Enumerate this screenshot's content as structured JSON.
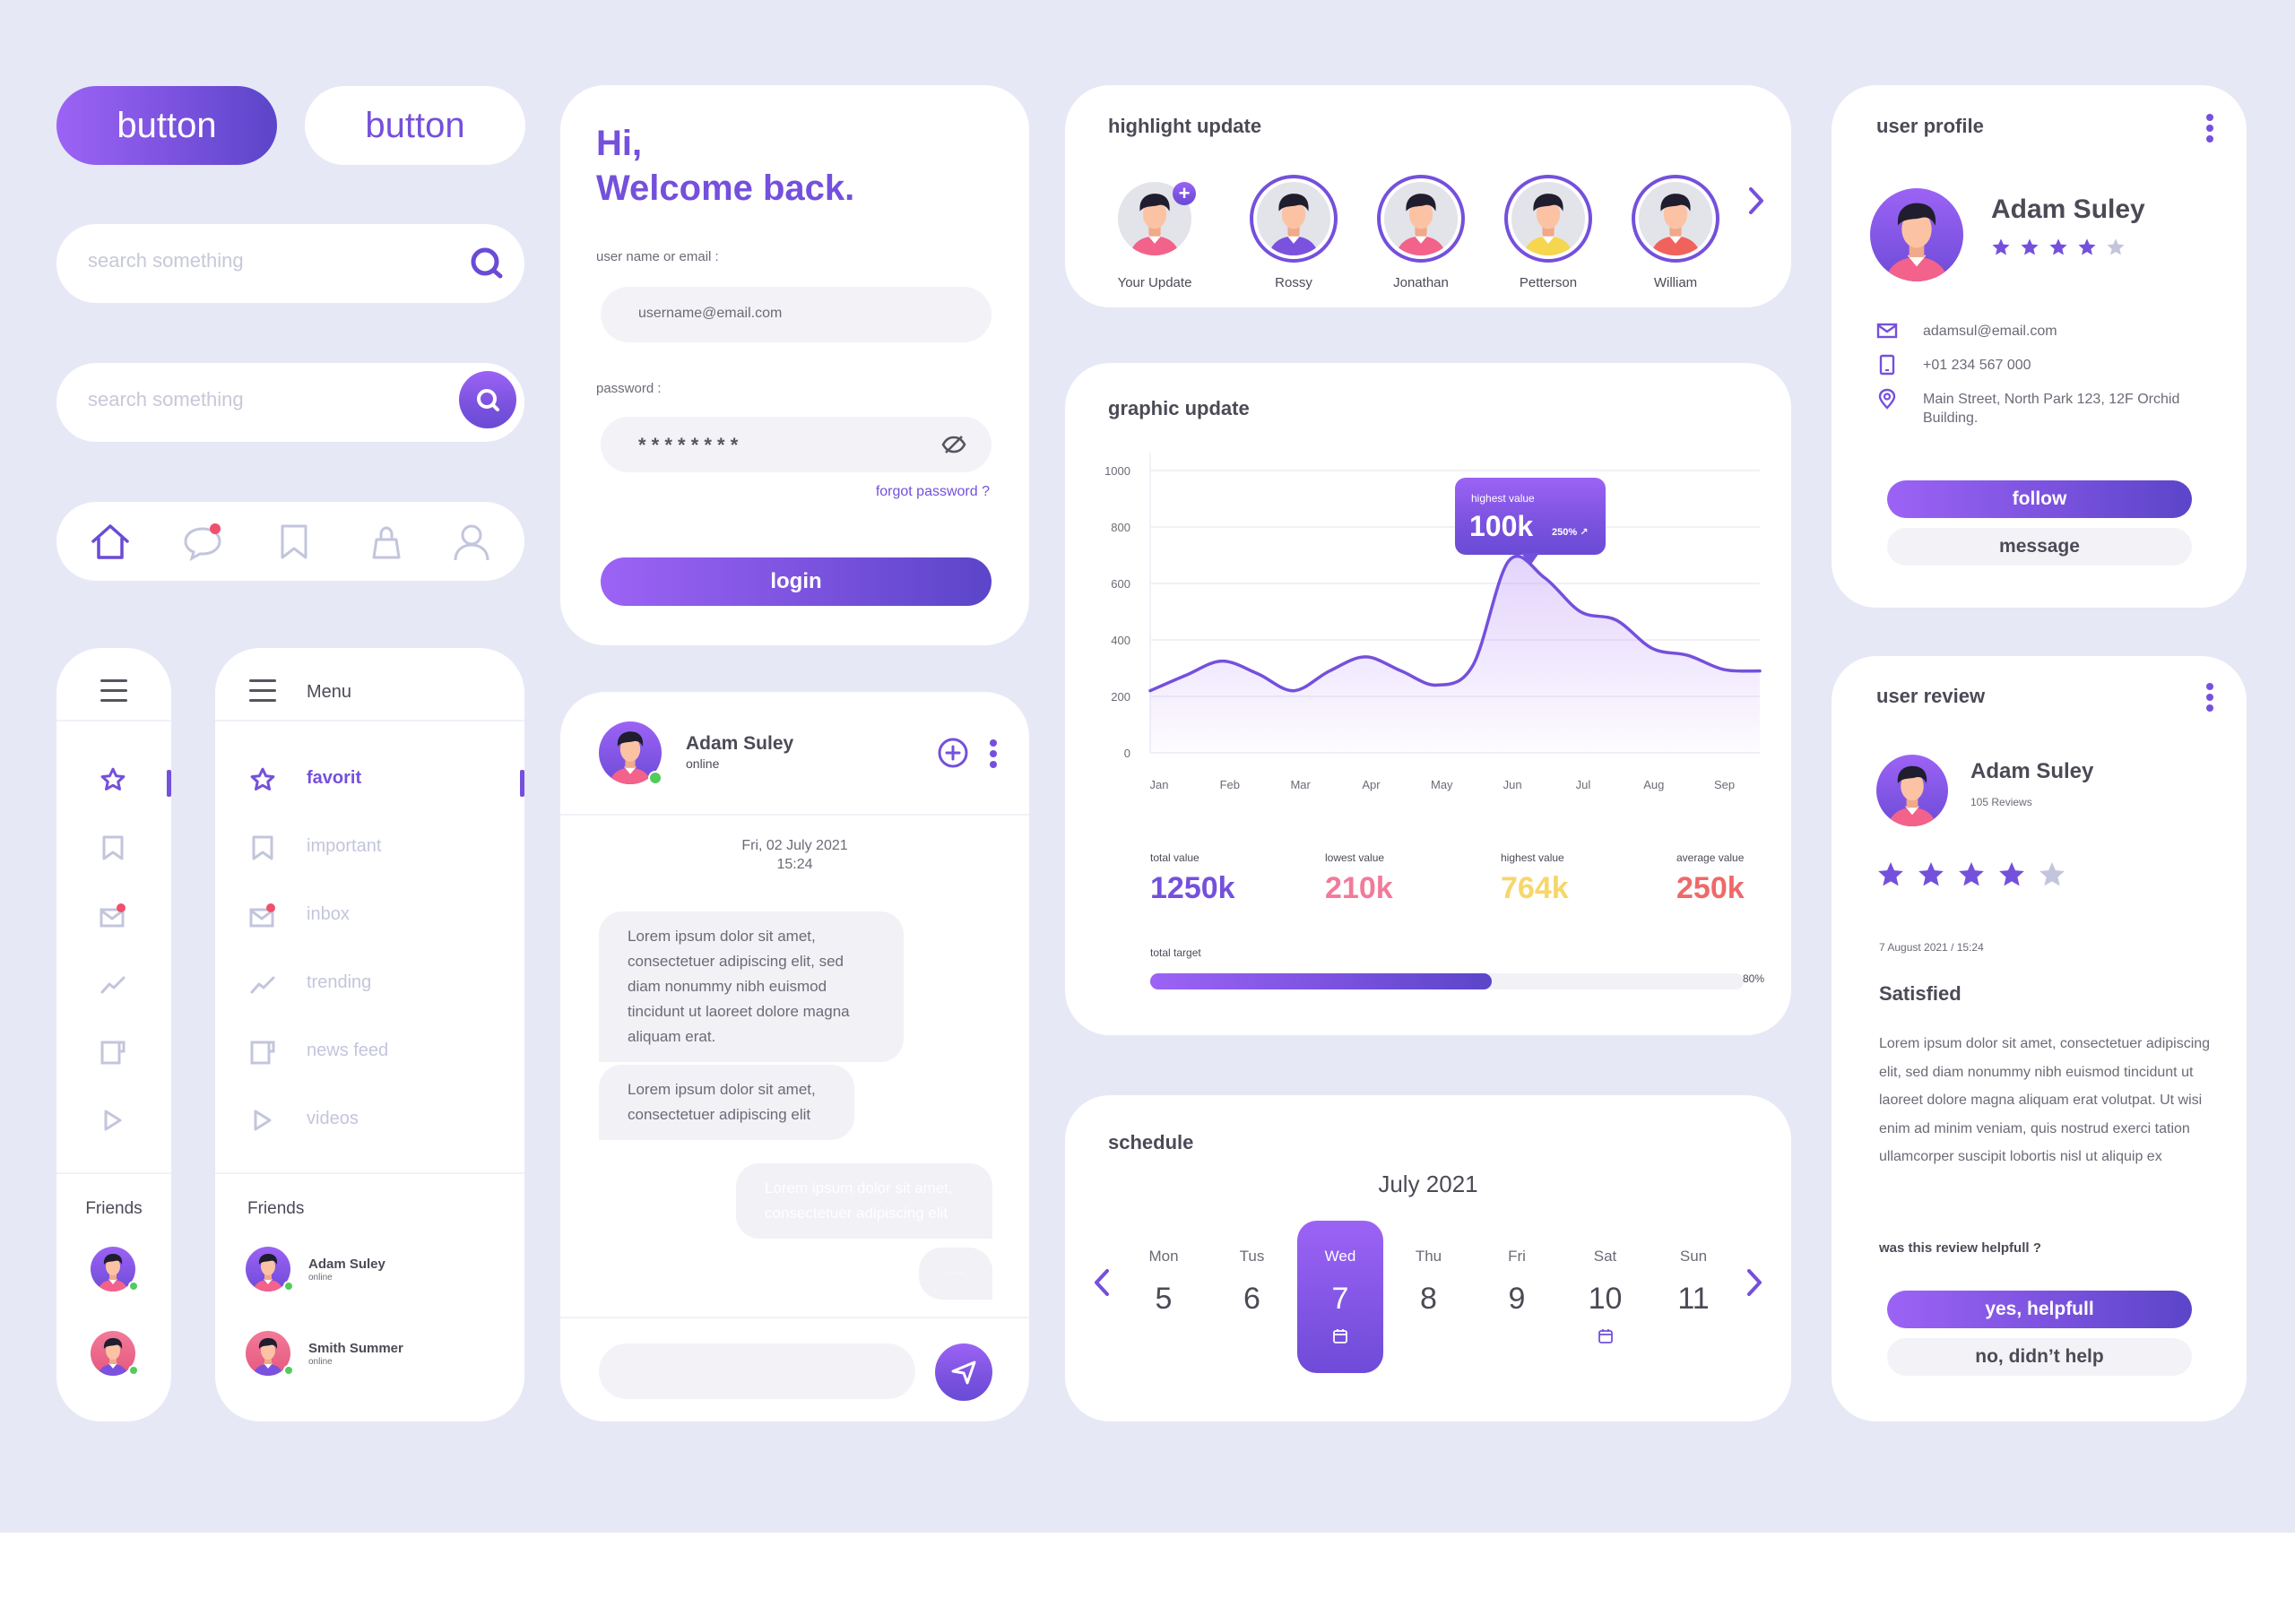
{
  "colors": {
    "background": "#e6e8f6",
    "accent": "#7450dc",
    "accent_light": "#9c63f5",
    "muted_icon": "#c3c5dc",
    "online": "#52cc5a",
    "notification": "#f0506e",
    "stat_total": "#7450dc",
    "stat_lowest": "#f27a9a",
    "stat_highest": "#f7d66a",
    "stat_average": "#f06868"
  },
  "buttons": {
    "primary_label": "button",
    "secondary_label": "button"
  },
  "search": {
    "placeholder_1": "search something",
    "placeholder_2": "search something"
  },
  "bottom_nav": {
    "items": [
      {
        "icon": "home-icon",
        "active": true
      },
      {
        "icon": "chat-icon",
        "badge": true
      },
      {
        "icon": "bookmark-icon"
      },
      {
        "icon": "shopping-bag-icon"
      },
      {
        "icon": "user-icon"
      }
    ]
  },
  "sidebar": {
    "menu_title": "Menu",
    "items": [
      {
        "label": "favorit",
        "icon": "star-icon",
        "active": true
      },
      {
        "label": "important",
        "icon": "bookmark-icon"
      },
      {
        "label": "inbox",
        "icon": "mail-icon",
        "badge": true
      },
      {
        "label": "trending",
        "icon": "trending-icon"
      },
      {
        "label": "news feed",
        "icon": "news-feed-icon"
      },
      {
        "label": "videos",
        "icon": "play-icon"
      }
    ],
    "friends_title": "Friends",
    "friends": [
      {
        "name": "Adam Suley",
        "status": "online"
      },
      {
        "name": "Smith Summer",
        "status": "online"
      }
    ]
  },
  "login": {
    "greeting_line1": "Hi,",
    "greeting_line2": "Welcome back.",
    "username_label": "user name or email :",
    "username_placeholder": "username@email.com",
    "password_label": "password :",
    "password_value": "* * * * * * * *",
    "forgot_label": "forgot password ?",
    "login_label": "login"
  },
  "chat": {
    "contact_name": "Adam Suley",
    "contact_status": "online",
    "date": "Fri, 02 July 2021",
    "time": "15:24",
    "messages": [
      {
        "from": "them",
        "text": "Lorem ipsum dolor sit amet, consectetuer adipiscing elit, sed diam nonummy nibh euismod tincidunt ut laoreet dolore magna aliquam erat."
      },
      {
        "from": "them",
        "text": "Lorem ipsum dolor sit amet, consectetuer adipiscing elit"
      },
      {
        "from": "me",
        "text": "Lorem ipsum dolor sit amet, consectetuer adipiscing elit"
      },
      {
        "from": "me",
        "text": "......."
      }
    ],
    "input_placeholder": ""
  },
  "highlights": {
    "title": "highlight update",
    "items": [
      {
        "name": "Your Update",
        "shirt": "#f2628a",
        "own": true
      },
      {
        "name": "Rossy",
        "shirt": "#7a52de"
      },
      {
        "name": "Jonathan",
        "shirt": "#f2628a"
      },
      {
        "name": "Petterson",
        "shirt": "#f6d64e"
      },
      {
        "name": "William",
        "shirt": "#f0625c"
      }
    ]
  },
  "graphic": {
    "title": "graphic update",
    "tooltip_label": "highest value",
    "tooltip_value": "100k",
    "tooltip_change": "250% ↗",
    "stats": [
      {
        "label": "total value",
        "value": "1250k"
      },
      {
        "label": "lowest value",
        "value": "210k"
      },
      {
        "label": "highest value",
        "value": "764k"
      },
      {
        "label": "average value",
        "value": "250k"
      }
    ],
    "target_label": "total target",
    "target_percent_label": "80%",
    "target_fraction": 0.8
  },
  "chart_data": {
    "type": "area",
    "title": "graphic update",
    "categories": [
      "Jan",
      "Feb",
      "Mar",
      "Apr",
      "May",
      "Jun",
      "Jul",
      "Aug",
      "Sep"
    ],
    "x": [
      0,
      0.5,
      1,
      1.5,
      2,
      2.5,
      3,
      3.5,
      4,
      4.5,
      5,
      5.5,
      6,
      6.5,
      7,
      7.5,
      8,
      8.5
    ],
    "values": [
      220,
      275,
      325,
      280,
      220,
      290,
      340,
      290,
      240,
      310,
      680,
      620,
      500,
      470,
      370,
      345,
      295,
      290
    ],
    "yticks": [
      0,
      200,
      400,
      600,
      800,
      1000
    ],
    "ylim": [
      0,
      1000
    ],
    "grid": true,
    "xlabel": "",
    "ylabel": "",
    "annotation": {
      "label": "highest value",
      "value": "100k",
      "change": "250%",
      "at": "Jun"
    }
  },
  "schedule": {
    "title": "schedule",
    "month": "July 2021",
    "days": [
      {
        "name": "Mon",
        "date": "5"
      },
      {
        "name": "Tus",
        "date": "6"
      },
      {
        "name": "Wed",
        "date": "7",
        "selected": true,
        "event": true
      },
      {
        "name": "Thu",
        "date": "8"
      },
      {
        "name": "Fri",
        "date": "9"
      },
      {
        "name": "Sat",
        "date": "10",
        "event": true
      },
      {
        "name": "Sun",
        "date": "11"
      }
    ]
  },
  "profile": {
    "title": "user profile",
    "name": "Adam Suley",
    "rating": 4,
    "rating_max": 5,
    "email": "adamsul@email.com",
    "phone": "+01 234 567 000",
    "address": "Main Street, North Park 123, 12F Orchid Building.",
    "follow_label": "follow",
    "message_label": "message"
  },
  "review": {
    "title": "user review",
    "name": "Adam Suley",
    "reviews_count": "105 Reviews",
    "rating": 4,
    "rating_max": 5,
    "datetime": "7 August 2021 / 15:24",
    "headline": "Satisfied",
    "body": "Lorem ipsum dolor sit amet, consectetuer adipiscing elit, sed diam nonummy nibh euismod tincidunt ut laoreet dolore magna aliquam erat volutpat. Ut wisi enim ad minim veniam, quis nostrud exerci tation ullamcorper suscipit lobortis nisl ut aliquip ex",
    "question": "was this review helpfull ?",
    "yes_label": "yes, helpfull",
    "no_label": "no, didn’t help"
  }
}
